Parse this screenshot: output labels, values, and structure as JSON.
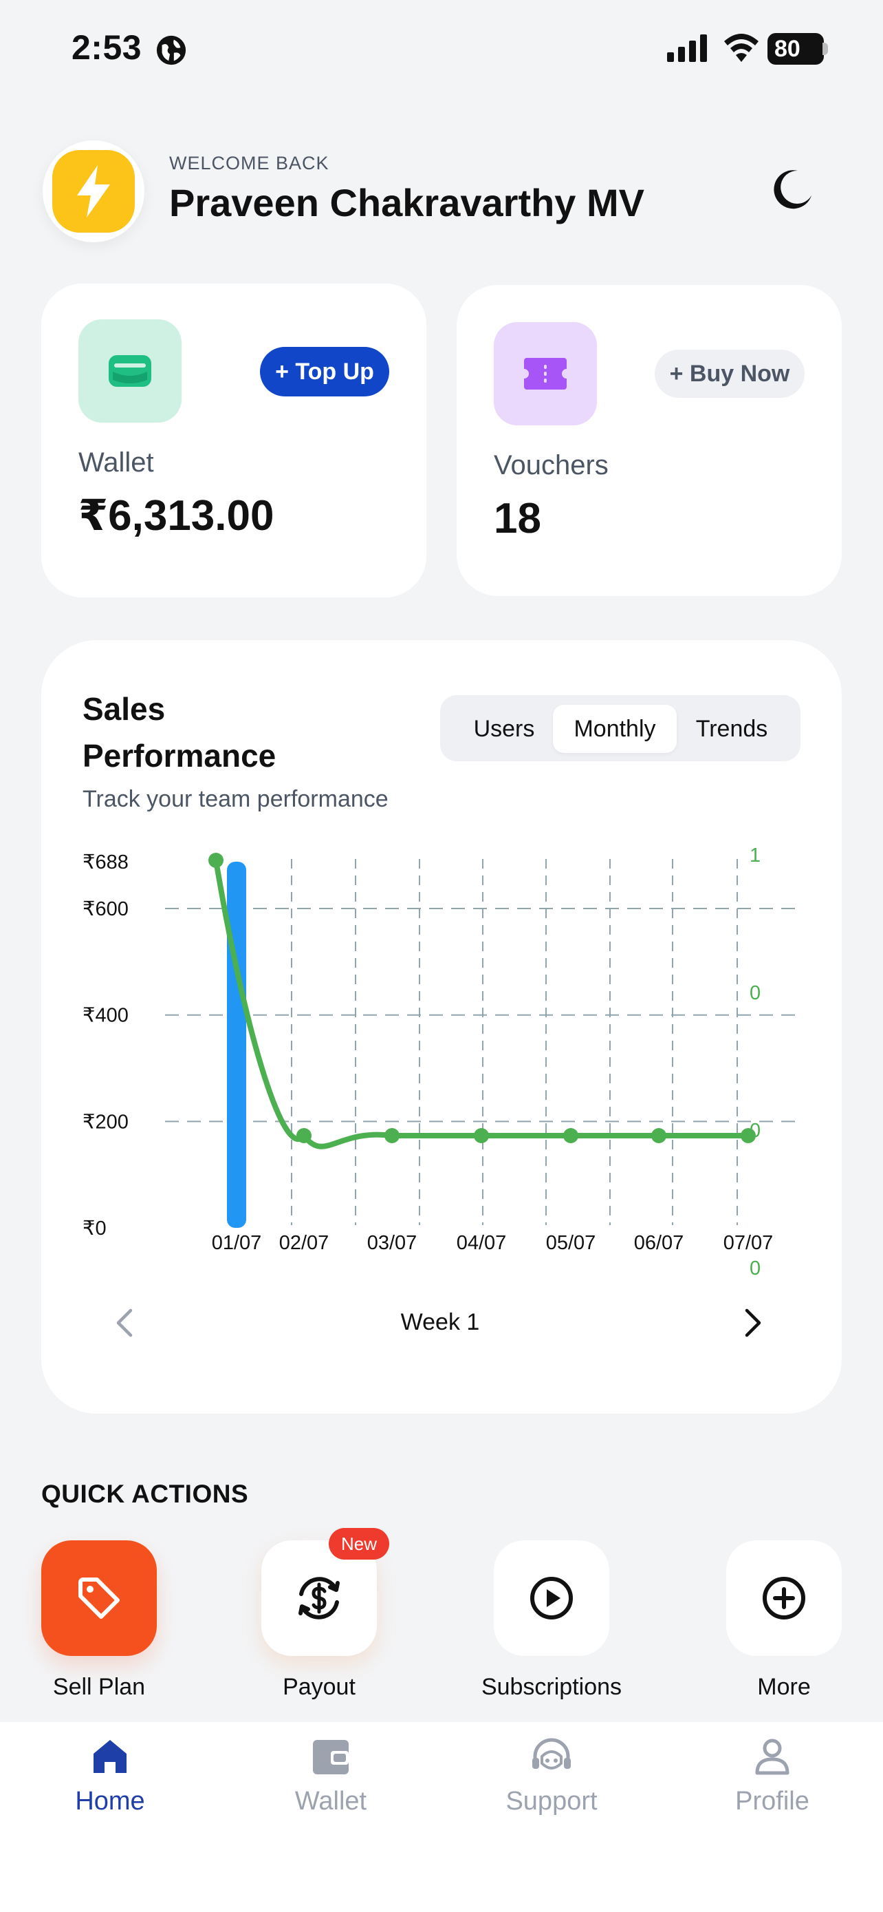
{
  "status_bar": {
    "time": "2:53",
    "battery": "80"
  },
  "header": {
    "welcome": "WELCOME BACK",
    "user_name": "Praveen Chakravarthy MV"
  },
  "wallet": {
    "label": "Wallet",
    "value": "₹6,313.00",
    "action": "+ Top Up"
  },
  "vouchers": {
    "label": "Vouchers",
    "value": "18",
    "action": "+ Buy Now"
  },
  "sales": {
    "title": "Sales Performance",
    "subtitle": "Track your team performance",
    "tabs": [
      "Users",
      "Monthly",
      "Trends"
    ],
    "selected_tab": "Monthly",
    "week_label": "Week 1"
  },
  "chart_data": {
    "type": "bar",
    "categories": [
      "01/07",
      "02/07",
      "03/07",
      "04/07",
      "05/07",
      "06/07",
      "07/07"
    ],
    "left_axis_ticks": [
      "₹688",
      "₹600",
      "₹400",
      "₹200",
      "₹0"
    ],
    "right_axis_ticks": [
      "1",
      "0",
      "0",
      "0"
    ],
    "ylim": [
      0,
      688
    ],
    "grid": true,
    "series": [
      {
        "type": "bar",
        "color": "#2196f3",
        "values": [
          688,
          0,
          0,
          0,
          0,
          0,
          0
        ]
      },
      {
        "type": "line",
        "color": "#4caf50",
        "values": [
          1,
          0,
          0,
          0,
          0,
          0,
          0
        ]
      }
    ]
  },
  "quick_actions": {
    "title": "QUICK ACTIONS",
    "items": [
      {
        "label": "Sell Plan",
        "icon": "tag-icon"
      },
      {
        "label": "Payout",
        "icon": "currency-refresh-icon",
        "badge": "New"
      },
      {
        "label": "Subscriptions",
        "icon": "play-circle-icon"
      },
      {
        "label": "More",
        "icon": "plus-circle-icon"
      }
    ]
  },
  "nav": {
    "items": [
      {
        "label": "Home",
        "icon": "home-icon",
        "active": true
      },
      {
        "label": "Wallet",
        "icon": "wallet-icon"
      },
      {
        "label": "Support",
        "icon": "headset-icon"
      },
      {
        "label": "Profile",
        "icon": "person-icon"
      }
    ]
  },
  "colors": {
    "accent": "#1146c8",
    "wallet_tile": "#cff1e3",
    "voucher_tile": "#ead9fd",
    "sell_plan": "#f4511e",
    "new_badge": "#ef3b2d",
    "bar": "#2196f3",
    "line": "#4caf50"
  }
}
